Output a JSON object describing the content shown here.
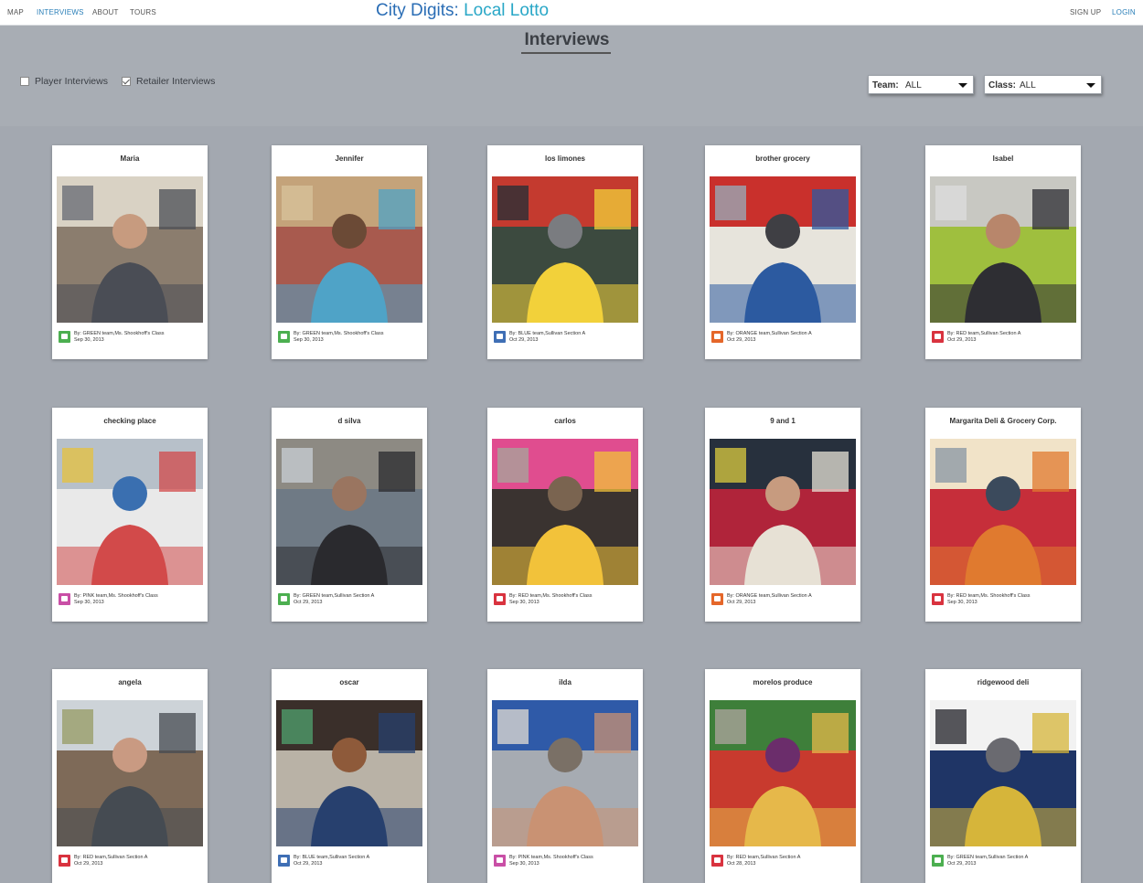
{
  "nav": {
    "map": "MAP",
    "interviews": "INTERVIEWS",
    "about": "ABOUT",
    "tours": "TOURS",
    "signup": "SIGN UP",
    "login": "LOGIN"
  },
  "brand": {
    "part1": "City Digits:",
    "part2": " Local Lotto"
  },
  "page": {
    "title": "Interviews"
  },
  "filters": {
    "player": {
      "label": "Player Interviews",
      "checked": false
    },
    "retailer": {
      "label": "Retailer Interviews",
      "checked": true
    },
    "team": {
      "label": "Team:",
      "value": "ALL"
    },
    "class": {
      "label": "Class:",
      "value": "ALL"
    }
  },
  "team_colors": {
    "GREEN": "#4caf50",
    "BLUE": "#3f6fb5",
    "ORANGE": "#e5672a",
    "RED": "#d9333f",
    "PINK": "#c94fa6"
  },
  "cards": [
    {
      "name": "Maria",
      "by": "By: GREEN team,Ms. Shookhoff's Class",
      "date": "Sep 30, 2013",
      "team": "GREEN"
    },
    {
      "name": "Jennifer",
      "by": "By: GREEN team,Ms. Shookhoff's Class",
      "date": "Sep 30, 2013",
      "team": "GREEN"
    },
    {
      "name": "los limones",
      "by": "By: BLUE team,Sullivan Section A",
      "date": "Oct 29, 2013",
      "team": "BLUE"
    },
    {
      "name": "brother grocery",
      "by": "By: ORANGE team,Sullivan Section A",
      "date": "Oct 29, 2013",
      "team": "ORANGE"
    },
    {
      "name": "Isabel",
      "by": "By: RED team,Sullivan Section A",
      "date": "Oct 29, 2013",
      "team": "RED"
    },
    {
      "name": "checking place",
      "by": "By: PINK team,Ms. Shookhoff's Class",
      "date": "Sep 30, 2013",
      "team": "PINK"
    },
    {
      "name": "d silva",
      "by": "By: GREEN team,Sullivan Section A",
      "date": "Oct 29, 2013",
      "team": "GREEN"
    },
    {
      "name": "carlos",
      "by": "By: RED team,Ms. Shookhoff's Class",
      "date": "Sep 30, 2013",
      "team": "RED"
    },
    {
      "name": "9 and 1",
      "by": "By: ORANGE team,Sullivan Section A",
      "date": "Oct 29, 2013",
      "team": "ORANGE"
    },
    {
      "name": "Margarita Deli & Grocery Corp.",
      "by": "By: RED team,Ms. Shookhoff's Class",
      "date": "Sep 30, 2013",
      "team": "RED"
    },
    {
      "name": "angela",
      "by": "By: RED team,Sullivan Section A",
      "date": "Oct 29, 2013",
      "team": "RED"
    },
    {
      "name": "oscar",
      "by": "By: BLUE team,Sullivan Section A",
      "date": "Oct 29, 2013",
      "team": "BLUE"
    },
    {
      "name": "ilda",
      "by": "By: PINK team,Ms. Shookhoff's Class",
      "date": "Sep 30, 2013",
      "team": "PINK"
    },
    {
      "name": "morelos produce",
      "by": "By: RED team,Sullivan Section A",
      "date": "Oct 28, 2013",
      "team": "RED"
    },
    {
      "name": "ridgewood deli",
      "by": "By: GREEN team,Sullivan Section A",
      "date": "Oct 29, 2013",
      "team": "GREEN"
    }
  ]
}
